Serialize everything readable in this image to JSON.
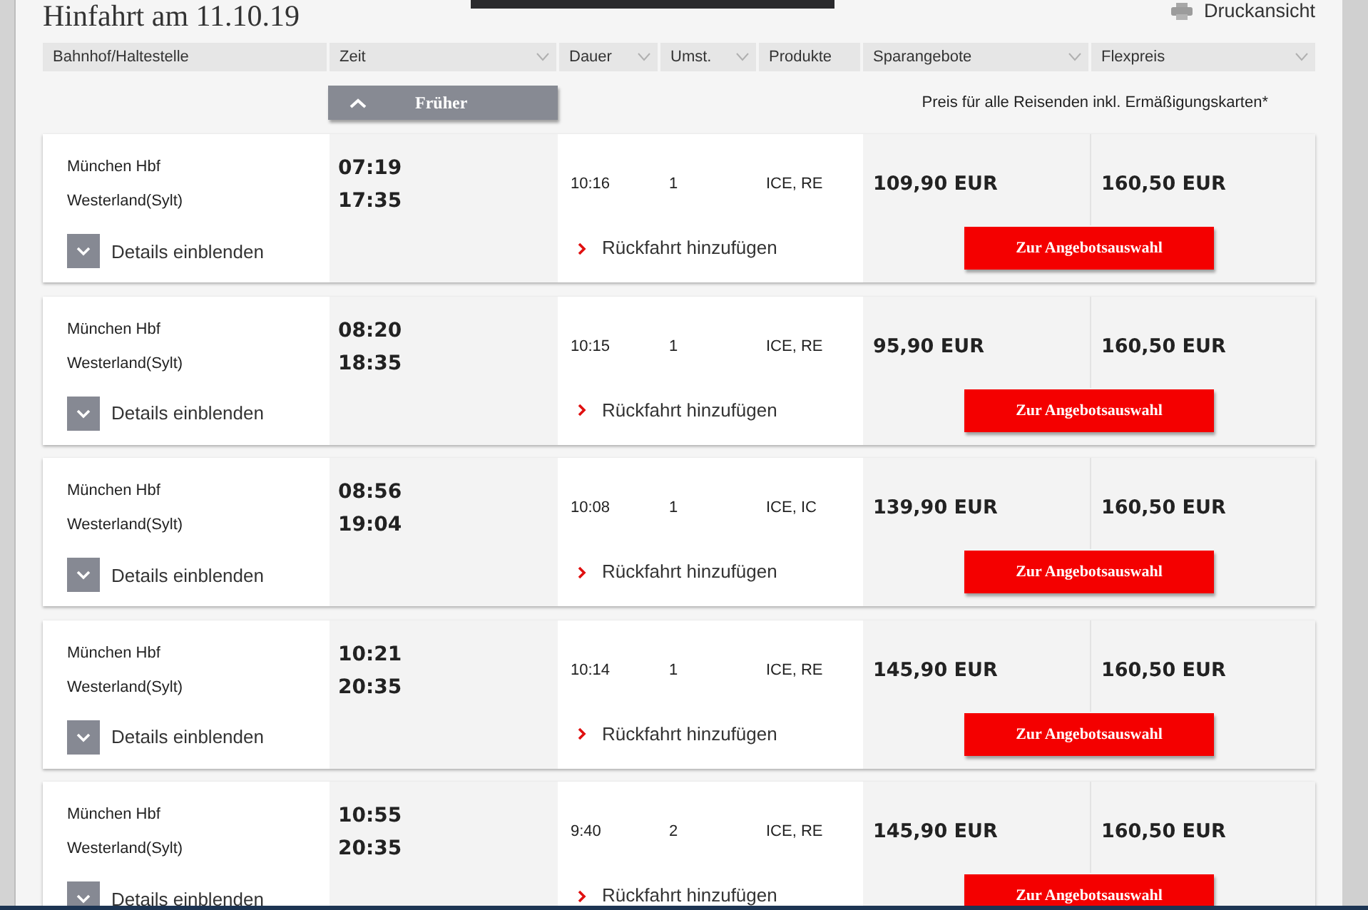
{
  "header": {
    "title": "Hinfahrt am 11.10.19",
    "print_link": "Druckansicht"
  },
  "table": {
    "columns": [
      {
        "label": "Bahnhof/Haltestelle",
        "sortable": false
      },
      {
        "label": "Zeit",
        "sortable": true
      },
      {
        "label": "Dauer",
        "sortable": true
      },
      {
        "label": "Umst.",
        "sortable": true
      },
      {
        "label": "Produkte",
        "sortable": false
      },
      {
        "label": "Sparangebote",
        "sortable": true
      },
      {
        "label": "Flexpreis",
        "sortable": true
      }
    ],
    "earlier_button": "Früher",
    "price_note": "Preis für alle Reisenden inkl. Ermäßigungskarten*",
    "rows": [
      {
        "from": "München Hbf",
        "to": "Westerland(Sylt)",
        "departure": "07:19",
        "arrival": "17:35",
        "duration": "10:16",
        "changes": "1",
        "products": "ICE, RE",
        "saver_price": "109,90 EUR",
        "flex_price": "160,50 EUR",
        "details_label": "Details einblenden",
        "return_label": "Rückfahrt hinzufügen",
        "offer_button": "Zur Angebotsauswahl"
      },
      {
        "from": "München Hbf",
        "to": "Westerland(Sylt)",
        "departure": "08:20",
        "arrival": "18:35",
        "duration": "10:15",
        "changes": "1",
        "products": "ICE, RE",
        "saver_price": "95,90 EUR",
        "flex_price": "160,50 EUR",
        "details_label": "Details einblenden",
        "return_label": "Rückfahrt hinzufügen",
        "offer_button": "Zur Angebotsauswahl"
      },
      {
        "from": "München Hbf",
        "to": "Westerland(Sylt)",
        "departure": "08:56",
        "arrival": "19:04",
        "duration": "10:08",
        "changes": "1",
        "products": "ICE, IC",
        "saver_price": "139,90 EUR",
        "flex_price": "160,50 EUR",
        "details_label": "Details einblenden",
        "return_label": "Rückfahrt hinzufügen",
        "offer_button": "Zur Angebotsauswahl"
      },
      {
        "from": "München Hbf",
        "to": "Westerland(Sylt)",
        "departure": "10:21",
        "arrival": "20:35",
        "duration": "10:14",
        "changes": "1",
        "products": "ICE, RE",
        "saver_price": "145,90 EUR",
        "flex_price": "160,50 EUR",
        "details_label": "Details einblenden",
        "return_label": "Rückfahrt hinzufügen",
        "offer_button": "Zur Angebotsauswahl"
      },
      {
        "from": "München Hbf",
        "to": "Westerland(Sylt)",
        "departure": "10:55",
        "arrival": "20:35",
        "duration": "9:40",
        "changes": "2",
        "products": "ICE, RE",
        "saver_price": "145,90 EUR",
        "flex_price": "160,50 EUR",
        "details_label": "Details einblenden",
        "return_label": "Rückfahrt hinzufügen",
        "offer_button": "Zur Angebotsauswahl"
      }
    ]
  }
}
